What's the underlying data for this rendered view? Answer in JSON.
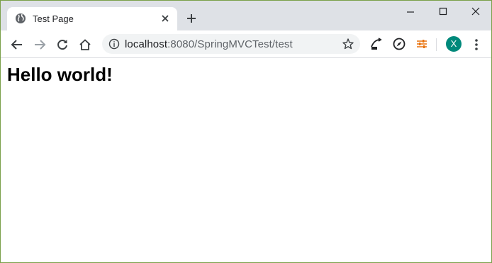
{
  "tab": {
    "title": "Test Page",
    "favicon_icon": "globe-icon"
  },
  "omnibox": {
    "url_host": "localhost",
    "url_rest": ":8080/SpringMVCTest/test"
  },
  "profile": {
    "initial": "X",
    "color": "#00897b"
  },
  "page": {
    "heading": "Hello world!"
  },
  "colors": {
    "tabstrip": "#dee1e6",
    "accent_border": "#7aa04a",
    "extension_orange": "#e8710a"
  }
}
